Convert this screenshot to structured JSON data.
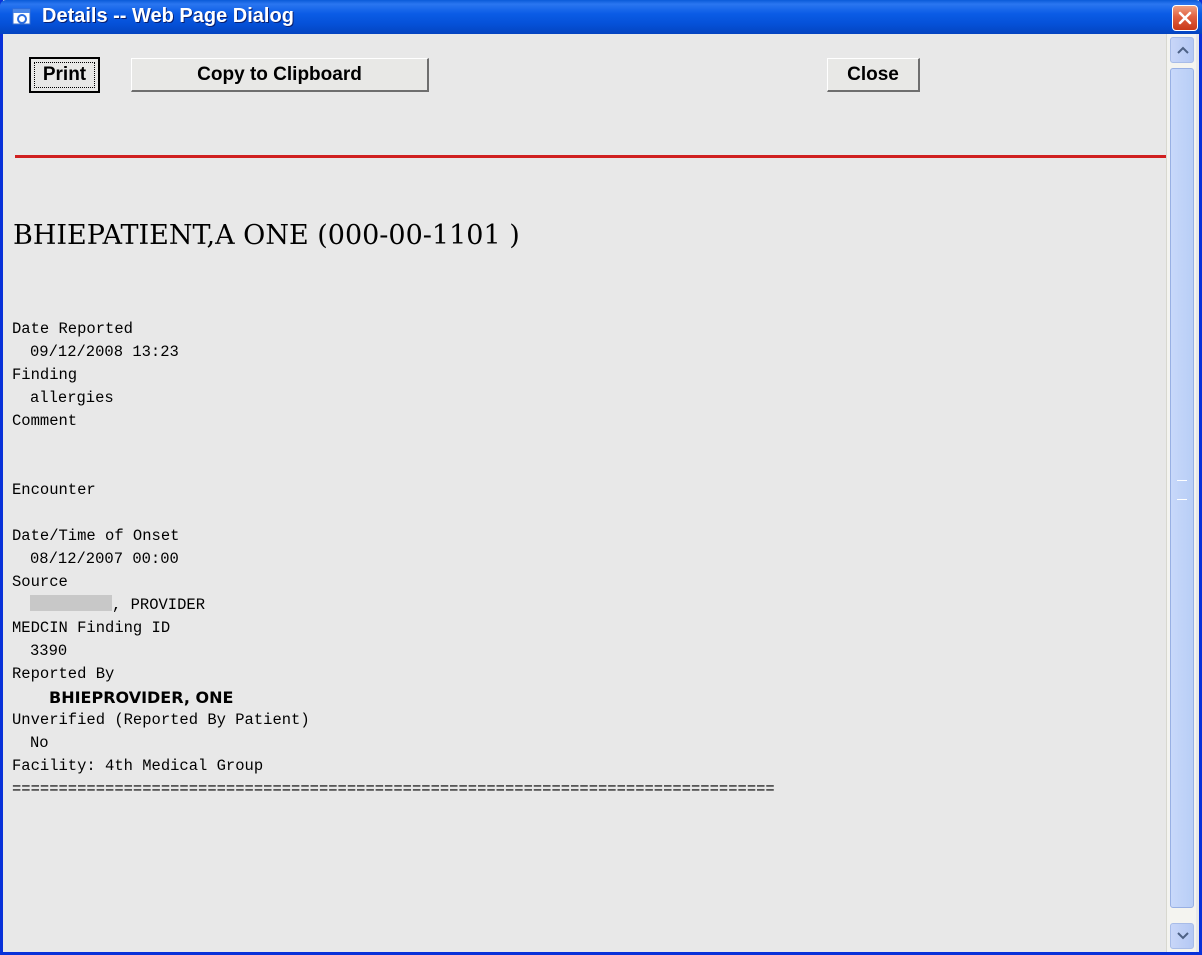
{
  "window": {
    "title": "Details -- Web Page Dialog",
    "title_icon": "ie-icon",
    "close_icon": "close-icon"
  },
  "toolbar": {
    "print_label": "Print",
    "copy_label": "Copy to Clipboard",
    "close_label": "Close"
  },
  "patient": {
    "header": "BHIEPATIENT,A ONE (000-00-1101 )"
  },
  "report": {
    "date_reported_label": "Date Reported",
    "date_reported_value": "09/12/2008 13:23",
    "finding_label": "Finding",
    "finding_value": "allergies",
    "comment_label": "Comment",
    "encounter_label": "Encounter",
    "onset_label": "Date/Time of Onset",
    "onset_value": "08/12/2007 00:00",
    "source_label": "Source",
    "source_value": ", PROVIDER",
    "medcin_label": "MEDCIN Finding ID",
    "medcin_value": "3390",
    "reported_by_label": "Reported By",
    "reported_by_value": "BHIEPROVIDER, ONE",
    "unverified_label": "Unverified (Reported By Patient)",
    "unverified_value": "No",
    "facility": "Facility: 4th Medical Group",
    "separator": "=================================================================================="
  },
  "colors": {
    "titlebar": "#0b5ce6",
    "divider": "#d02020",
    "content_bg": "#e8e8e8"
  }
}
